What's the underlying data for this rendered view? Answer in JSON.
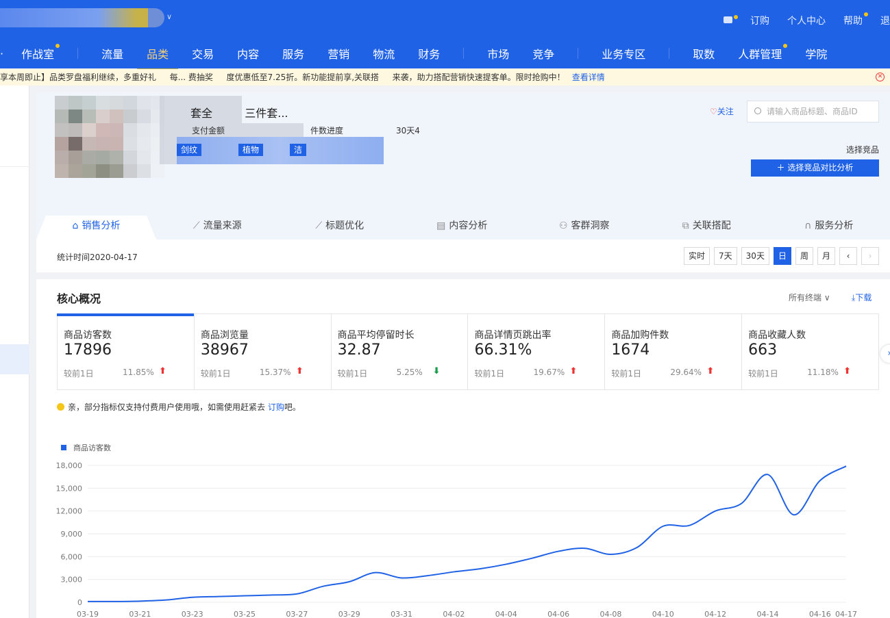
{
  "header": {
    "toplinks": [
      "订购",
      "个人中心",
      "帮助",
      "退"
    ],
    "nav": [
      "作战室",
      "流量",
      "品类",
      "交易",
      "内容",
      "服务",
      "营销",
      "物流",
      "财务",
      "市场",
      "竞争",
      "业务专区",
      "取数",
      "人群管理",
      "学院"
    ],
    "active_nav": "品类"
  },
  "notice": {
    "text": "享本周即止】品类罗盘福利继续，多重好礼 　 每... 费抽奖 　 度优惠低至7.25折。新功能提前享,关联搭 　 来袭，助力搭配营销快速提客单。限时抢购中！",
    "link": "查看详情"
  },
  "product": {
    "title": "套全 　 　 三件套...",
    "meta": [
      "支付金额",
      "件数进度",
      "30天4"
    ],
    "tags": [
      "剑纹",
      "植物",
      "洁"
    ],
    "follow": "关注",
    "search_placeholder": "请输入商品标题、商品ID",
    "choose_label": "选择竞品",
    "compare_button": "＋ 选择竞品对比分析"
  },
  "tabs": [
    {
      "label": "销售分析",
      "icon": "bag-icon"
    },
    {
      "label": "流量来源",
      "icon": "trend-icon"
    },
    {
      "label": "标题优化",
      "icon": "trend-icon"
    },
    {
      "label": "内容分析",
      "icon": "doc-icon"
    },
    {
      "label": "客群洞察",
      "icon": "users-icon"
    },
    {
      "label": "关联搭配",
      "icon": "link-icon"
    },
    {
      "label": "服务分析",
      "icon": "headset-icon"
    }
  ],
  "stat_time": "统计时间2020-04-17",
  "date_buttons": [
    "实时",
    "7天",
    "30天",
    "日",
    "周",
    "月"
  ],
  "date_active": "日",
  "core": {
    "title": "核心概况",
    "terminal": "所有终端",
    "download": "下载",
    "metrics": [
      {
        "name": "商品访客数",
        "value": "17896",
        "compare": "较前1日",
        "pct": "11.85%",
        "dir": "up"
      },
      {
        "name": "商品浏览量",
        "value": "38967",
        "compare": "较前1日",
        "pct": "15.37%",
        "dir": "up"
      },
      {
        "name": "商品平均停留时长",
        "value": "32.87",
        "compare": "较前1日",
        "pct": "5.25%",
        "dir": "down"
      },
      {
        "name": "商品详情页跳出率",
        "value": "66.31%",
        "compare": "较前1日",
        "pct": "19.67%",
        "dir": "up"
      },
      {
        "name": "商品加购件数",
        "value": "1674",
        "compare": "较前1日",
        "pct": "29.64%",
        "dir": "up"
      },
      {
        "name": "商品收藏人数",
        "value": "663",
        "compare": "较前1日",
        "pct": "11.18%",
        "dir": "up"
      }
    ],
    "tip": {
      "text": "亲，部分指标仅支持付费用户使用哦，如需使用赶紧去 ",
      "link": "订购",
      "tail": "吧。"
    }
  },
  "chart_data": {
    "type": "line",
    "legend": "top-left",
    "grid": true,
    "color": "#2062e6",
    "x": [
      "03-19",
      "03-20",
      "03-21",
      "03-22",
      "03-23",
      "03-24",
      "03-25",
      "03-26",
      "03-27",
      "03-28",
      "03-29",
      "03-30",
      "03-31",
      "04-01",
      "04-02",
      "04-03",
      "04-04",
      "04-05",
      "04-06",
      "04-07",
      "04-08",
      "04-09",
      "04-10",
      "04-11",
      "04-12",
      "04-13",
      "04-14",
      "04-15",
      "04-16",
      "04-17"
    ],
    "xticks": [
      "03-19",
      "03-21",
      "03-23",
      "03-25",
      "03-27",
      "03-29",
      "03-31",
      "04-02",
      "04-04",
      "04-06",
      "04-08",
      "04-10",
      "04-12",
      "04-14",
      "04-16",
      "04-17"
    ],
    "yticks": [
      "0",
      "3,000",
      "6,000",
      "9,000",
      "12,000",
      "15,000",
      "18,000"
    ],
    "ylim": [
      0,
      18000
    ],
    "series": [
      {
        "name": "商品访客数",
        "values": [
          100,
          100,
          150,
          300,
          650,
          750,
          850,
          950,
          1100,
          2100,
          2700,
          3900,
          3200,
          3500,
          4000,
          4400,
          5000,
          5800,
          6700,
          7100,
          6300,
          7200,
          10000,
          10100,
          12000,
          13000,
          16800,
          11500,
          16000,
          17896
        ]
      }
    ]
  }
}
